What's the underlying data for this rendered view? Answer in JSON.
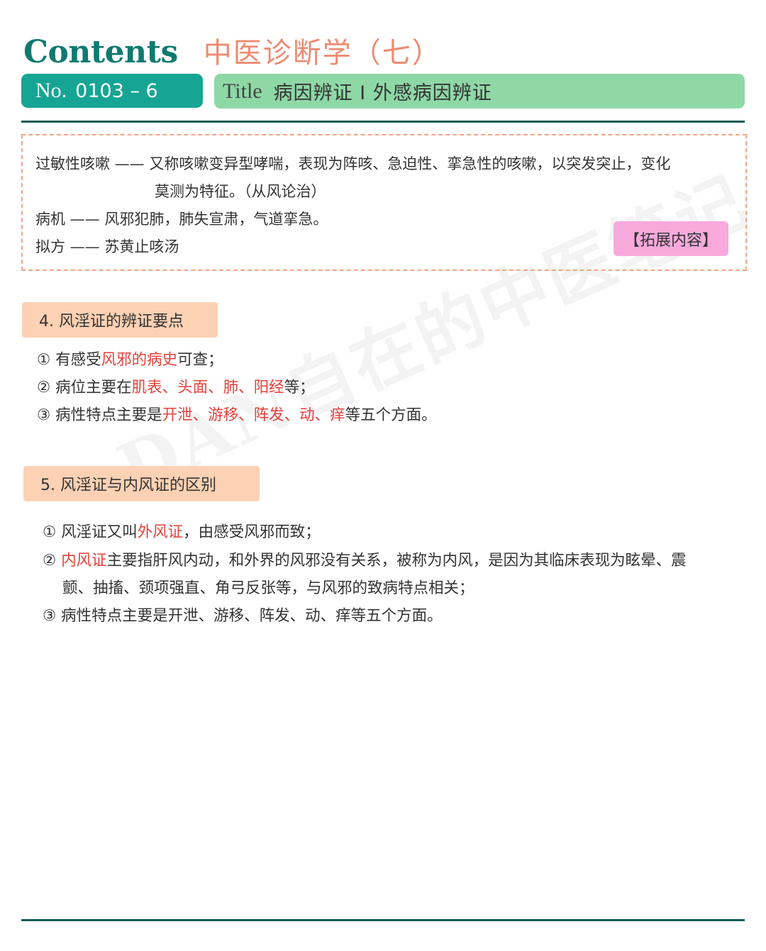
{
  "header": {
    "contents_label": "Contents",
    "subject": "中医诊断学（七）",
    "no_label": "No.",
    "no_value": "0103 – 6",
    "title_label": "Title",
    "title_value": "病因辨证 I 外感病因辨证"
  },
  "extension": {
    "line1": {
      "term": "过敏性咳嗽",
      "dash": " —— ",
      "text": "又称咳嗽变异型哮喘，表现为阵咳、急迫性、挛急性的咳嗽，以突发突止，变化"
    },
    "line2": "莫测为特征。（从风论治）",
    "line3": {
      "term": "病机",
      "dash": " —— ",
      "text": "风邪犯肺，肺失宣肃，气道挛急。"
    },
    "line4": {
      "term": "拟方",
      "dash": " —— ",
      "text": "苏黄止咳汤"
    },
    "tag": "【拓展内容】"
  },
  "section4": {
    "heading": "4.  风淫证的辨证要点",
    "items": [
      {
        "num": "①",
        "a": " 有感受",
        "red": "风邪的病史",
        "b": "可查；"
      },
      {
        "num": "②",
        "a": " 病位主要在",
        "red": "肌表、头面、肺、阳经",
        "b": "等；"
      },
      {
        "num": "③",
        "a": " 病性特点主要是",
        "red": "开泄、游移、阵发、动、痒",
        "b": "等五个方面。"
      }
    ]
  },
  "section5": {
    "heading": "5.  风淫证与内风证的区别",
    "item1": {
      "num": "①",
      "a": " 风淫证又叫",
      "red": "外风证",
      "b": "，由感受风邪而致；"
    },
    "item2": {
      "num": "②",
      "red": " 内风证",
      "b": "主要指肝风内动，和外界的风邪没有关系，被称为内风，是因为其临床表现为眩晕、震"
    },
    "item2_cont": "颤、抽搐、颈项强直、角弓反张等，与风邪的致病特点相关；",
    "item3": {
      "num": "③",
      "a": " 病性特点主要是开泄、游移、阵发、动、痒等五个方面。"
    }
  },
  "watermark": "DAN自在的中医笔记",
  "colors": {
    "teal": "#16a594",
    "dark_teal": "#0f7b70",
    "mint": "#8ed8a6",
    "salmon": "#ec8c73",
    "peach": "#fcd1b4",
    "pink": "#f8a9dc",
    "red": "#e6413b"
  }
}
